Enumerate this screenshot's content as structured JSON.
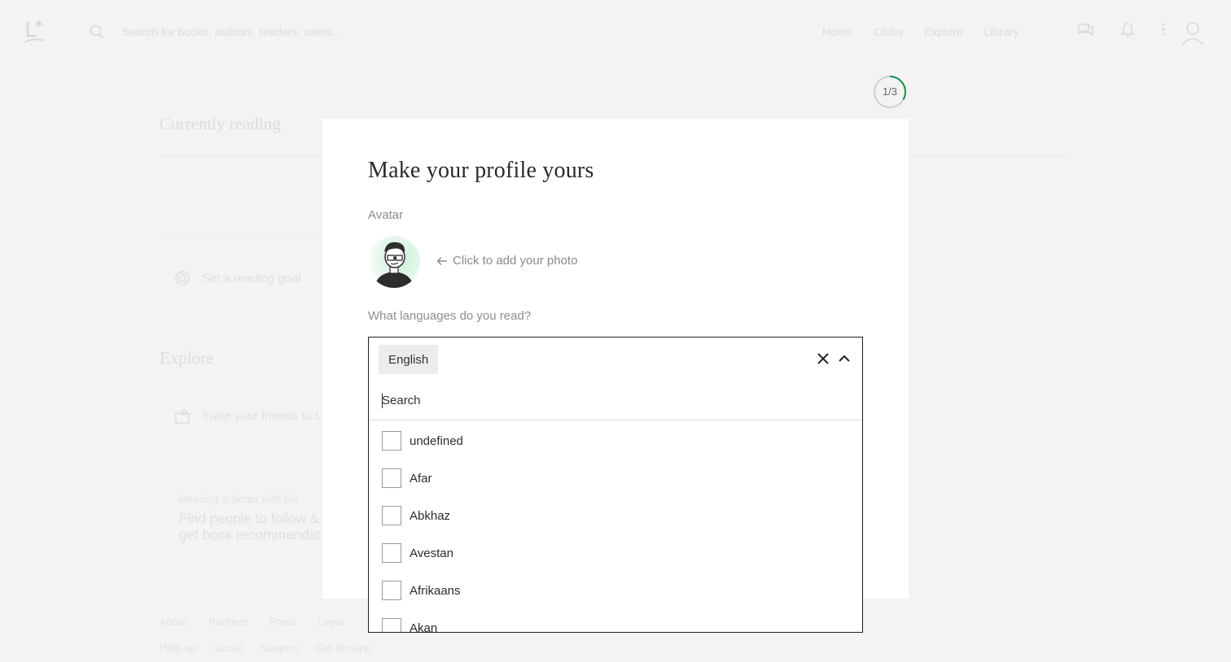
{
  "background": {
    "search_placeholder": "Search for books, authors, readers, users...",
    "nav": [
      "Home",
      "Clubs",
      "Explore",
      "Library"
    ],
    "currently_reading_heading": "Currently reading",
    "reading_goal_label": "Set a reading goal",
    "explore_heading": "Explore",
    "invite_label": "Invite your friends to L...",
    "reading_better_label": "Reading is better with frie...",
    "find_people_line1": "Find people to follow &",
    "find_people_line2": "get book recommendat...",
    "footer_links": [
      "About",
      "Partners",
      "Press",
      "Legal"
    ],
    "footer_menus": [
      "Help up",
      "Social",
      "Support",
      "Get the app"
    ]
  },
  "onboarding": {
    "step_label": "1/3",
    "step_progress": 0.333
  },
  "modal": {
    "title": "Make your profile yours",
    "avatar_label": "Avatar",
    "avatar_hint": "Click to add your photo",
    "languages_label": "What languages do you read?",
    "selected_languages": [
      "English"
    ],
    "search_placeholder": "Search",
    "options": [
      "undefined",
      "Afar",
      "Abkhaz",
      "Avestan",
      "Afrikaans",
      "Akan"
    ]
  },
  "colors": {
    "accent_green": "#1e8c4e",
    "border_dark": "#1f1f1f",
    "chip_bg": "#ececec"
  },
  "icons": {
    "arrow": "arrow-left-icon",
    "clear": "close-icon",
    "collapse": "chevron-up-icon"
  }
}
